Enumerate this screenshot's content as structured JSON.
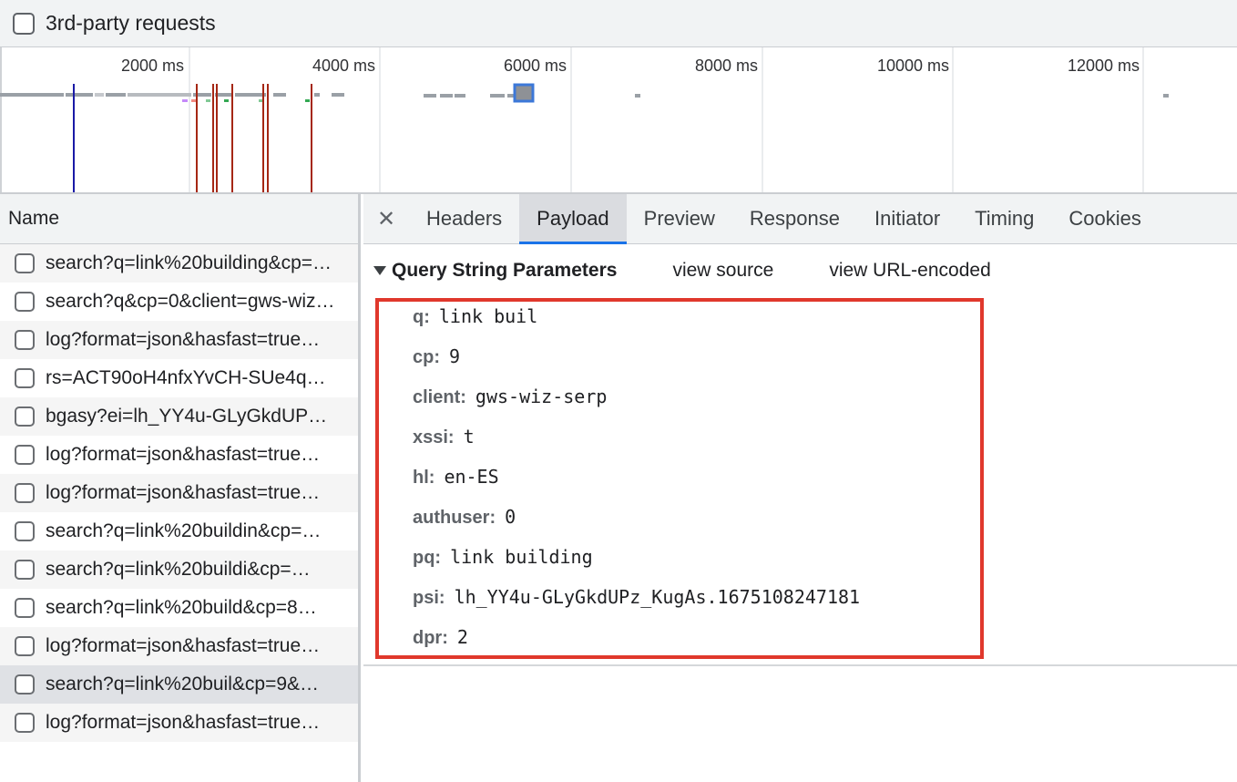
{
  "filter": {
    "third_party_label": "3rd-party requests",
    "third_party_checked": false
  },
  "overview": {
    "ticks": [
      "2000 ms",
      "4000 ms",
      "6000 ms",
      "8000 ms",
      "10000 ms",
      "12000 ms"
    ],
    "colors": {
      "dom_content_loaded": "#1a1aa6",
      "load": "#a52714",
      "request_bar": "#9aa0a6",
      "selection": "#3c78d8"
    }
  },
  "request_list": {
    "header": "Name",
    "rows": [
      {
        "name": "search?q=link%20building&cp=…",
        "selected": false
      },
      {
        "name": "search?q&cp=0&client=gws-wiz…",
        "selected": false
      },
      {
        "name": "log?format=json&hasfast=true…",
        "selected": false
      },
      {
        "name": "rs=ACT90oH4nfxYvCH-SUe4q…",
        "selected": false
      },
      {
        "name": "bgasy?ei=lh_YY4u-GLyGkdUP…",
        "selected": false
      },
      {
        "name": "log?format=json&hasfast=true…",
        "selected": false
      },
      {
        "name": "log?format=json&hasfast=true…",
        "selected": false
      },
      {
        "name": "search?q=link%20buildin&cp=…",
        "selected": false
      },
      {
        "name": "search?q=link%20buildi&cp=…",
        "selected": false
      },
      {
        "name": "search?q=link%20build&cp=8…",
        "selected": false
      },
      {
        "name": "log?format=json&hasfast=true…",
        "selected": false
      },
      {
        "name": "search?q=link%20buil&cp=9&…",
        "selected": true
      },
      {
        "name": "log?format=json&hasfast=true…",
        "selected": false
      }
    ]
  },
  "details": {
    "close_symbol": "✕",
    "tabs": [
      {
        "label": "Headers",
        "active": false
      },
      {
        "label": "Payload",
        "active": true
      },
      {
        "label": "Preview",
        "active": false
      },
      {
        "label": "Response",
        "active": false
      },
      {
        "label": "Initiator",
        "active": false
      },
      {
        "label": "Timing",
        "active": false
      },
      {
        "label": "Cookies",
        "active": false
      }
    ],
    "section_title": "Query String Parameters",
    "view_source": "view source",
    "view_url_encoded": "view URL-encoded",
    "highlight_color": "#e0382c",
    "params": [
      {
        "key": "q:",
        "value": "link buil"
      },
      {
        "key": "cp:",
        "value": "9"
      },
      {
        "key": "client:",
        "value": "gws-wiz-serp"
      },
      {
        "key": "xssi:",
        "value": "t"
      },
      {
        "key": "hl:",
        "value": "en-ES"
      },
      {
        "key": "authuser:",
        "value": "0"
      },
      {
        "key": "pq:",
        "value": "link building"
      },
      {
        "key": "psi:",
        "value": "lh_YY4u-GLyGkdUPz_KugAs.1675108247181"
      },
      {
        "key": "dpr:",
        "value": "2"
      }
    ]
  }
}
